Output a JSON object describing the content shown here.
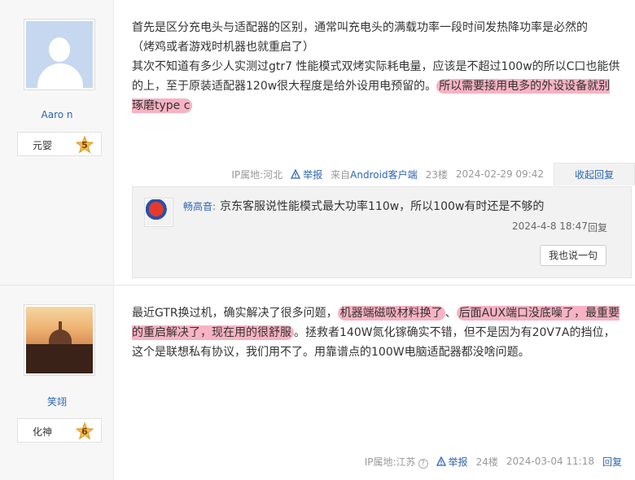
{
  "posts": [
    {
      "user": {
        "name": "Aaro n",
        "level_name": "元婴",
        "level_num": "5"
      },
      "content": {
        "line1": "首先是区分充电头与适配器的区别，通常叫充电头的满载功率一段时间发热降功率是必然的",
        "line2": "（烤鸡或者游戏时机器也就重启了）",
        "para2_plain": "其次不知道有多少人实测过gtr7 性能模式双烤实际耗电量，应该是不超过100w的所以C口也能供的上，至于原装适配器120w很大程度是给外设用电预留的。",
        "para2_hl": "所以需要接用电多的外设设备就别琢磨type c"
      },
      "meta": {
        "ip": "IP属地:河北",
        "report": "举报",
        "client_prefix": "来自",
        "client": "Android客户端",
        "floor": "23楼",
        "time": "2024-02-29 09:42",
        "reply_toggle": "收起回复"
      },
      "subreply": {
        "name": "畅高音:",
        "text": "京东客服说性能模式最大功率110w，所以100w有时还是不够的",
        "time": "2024-4-8 18:47",
        "reply": "回复",
        "button": "我也说一句"
      }
    },
    {
      "user": {
        "name": "笑翊",
        "level_name": "化神",
        "level_num": "6"
      },
      "content": {
        "p1": "最近GTR换过机，确实解决了很多问题，",
        "hl1": "机器端磁吸材料换了",
        "p2": "、",
        "hl2": "后面AUX端口没底噪了，最重要的重启解决了，现在用的很舒服",
        "p3": "。拯救者140W氮化镓确实不错，但不是因为有20V7A的挡位，这个是联想私有协议，我们用不了。用靠谱点的100W电脑适配器都没啥问题。"
      },
      "meta": {
        "ip": "IP属地:江苏",
        "report": "举报",
        "floor": "24楼",
        "time": "2024-03-04 11:18",
        "reply": "回复"
      }
    }
  ]
}
